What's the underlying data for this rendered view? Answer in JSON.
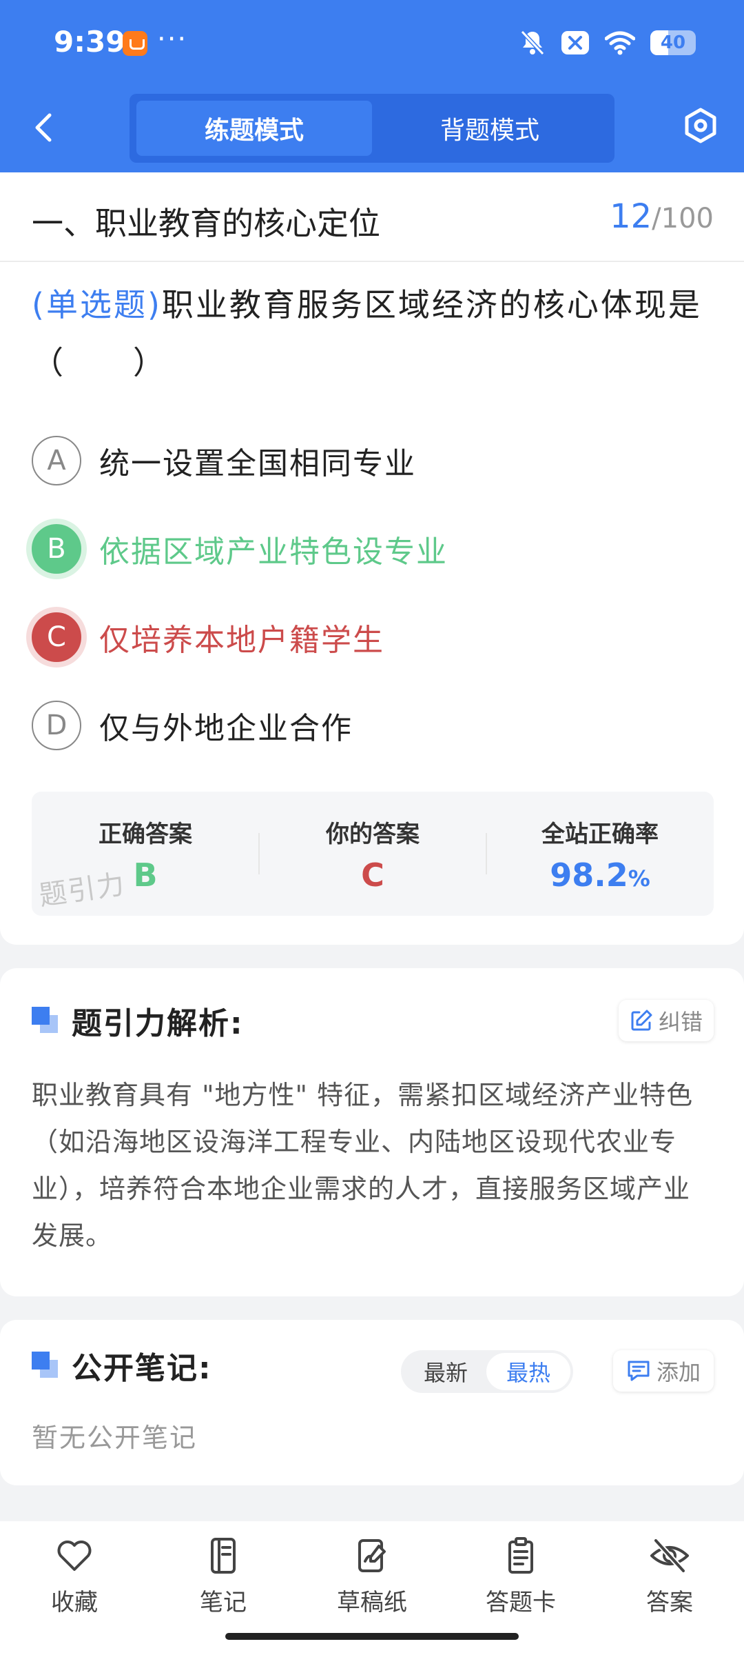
{
  "status_bar": {
    "time": "9:39",
    "dots": "···",
    "battery": "40"
  },
  "header": {
    "tabs": [
      {
        "label": "练题模式",
        "active": true
      },
      {
        "label": "背题模式",
        "active": false
      }
    ]
  },
  "section": {
    "title": "一、职业教育的核心定位",
    "current": "12",
    "total": "/100"
  },
  "question": {
    "type": "(单选题)",
    "text": "职业教育服务区域经济的核心体现是（　　）",
    "options": [
      {
        "letter": "A",
        "text": "统一设置全国相同专业",
        "state": "normal"
      },
      {
        "letter": "B",
        "text": "依据区域产业特色设专业",
        "state": "correct"
      },
      {
        "letter": "C",
        "text": "仅培养本地户籍学生",
        "state": "wrong"
      },
      {
        "letter": "D",
        "text": "仅与外地企业合作",
        "state": "normal"
      }
    ]
  },
  "answer_summary": {
    "correct_label": "正确答案",
    "correct_value": "B",
    "yours_label": "你的答案",
    "yours_value": "C",
    "rate_label": "全站正确率",
    "rate_value": "98.2",
    "rate_unit": "%",
    "watermark": "题引力"
  },
  "analysis": {
    "heading": "题引力解析:",
    "correction_label": "纠错",
    "text": "职业教育具有 \"地方性\" 特征，需紧扣区域经济产业特色（如沿海地区设海洋工程专业、内陆地区设现代农业专业），培养符合本地企业需求的人才，直接服务区域产业发展。"
  },
  "notes": {
    "heading": "公开笔记:",
    "sort_newest": "最新",
    "sort_hottest": "最热",
    "add_label": "添加",
    "empty_text": "暂无公开笔记"
  },
  "bottom_bar": {
    "items": [
      {
        "label": "收藏",
        "icon": "heart-icon"
      },
      {
        "label": "笔记",
        "icon": "notebook-icon"
      },
      {
        "label": "草稿纸",
        "icon": "draft-paper-icon"
      },
      {
        "label": "答题卡",
        "icon": "answer-sheet-icon"
      },
      {
        "label": "答案",
        "icon": "eye-off-icon"
      }
    ]
  },
  "colors": {
    "primary": "#3d7ef0",
    "correct": "#5ec98a",
    "wrong": "#cc4b4b"
  }
}
